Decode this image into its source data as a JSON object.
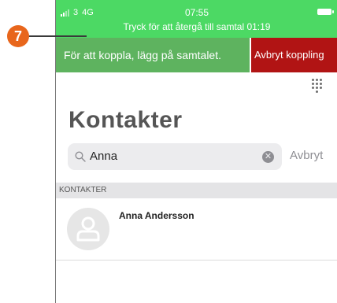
{
  "callout": {
    "number": "7"
  },
  "status_bar": {
    "carrier": "3",
    "network": "4G",
    "time": "07:55",
    "return_message": "Tryck för att återgå till samtal 01:19",
    "background_color": "#4cd964"
  },
  "transfer_bar": {
    "message": "För att koppla, lägg på samtalet.",
    "cancel_label": "Avbryt koppling",
    "message_color": "#5eb35f",
    "cancel_color": "#b11414"
  },
  "header": {
    "title": "Kontakter"
  },
  "search": {
    "value": "Anna",
    "cancel_label": "Avbryt"
  },
  "contacts": {
    "section_label": "KONTAKTER",
    "items": [
      {
        "name": "Anna Andersson"
      }
    ]
  },
  "icons": {
    "dialpad": "dialpad-icon",
    "search": "search-icon",
    "clear": "clear-icon",
    "avatar": "person-icon"
  }
}
